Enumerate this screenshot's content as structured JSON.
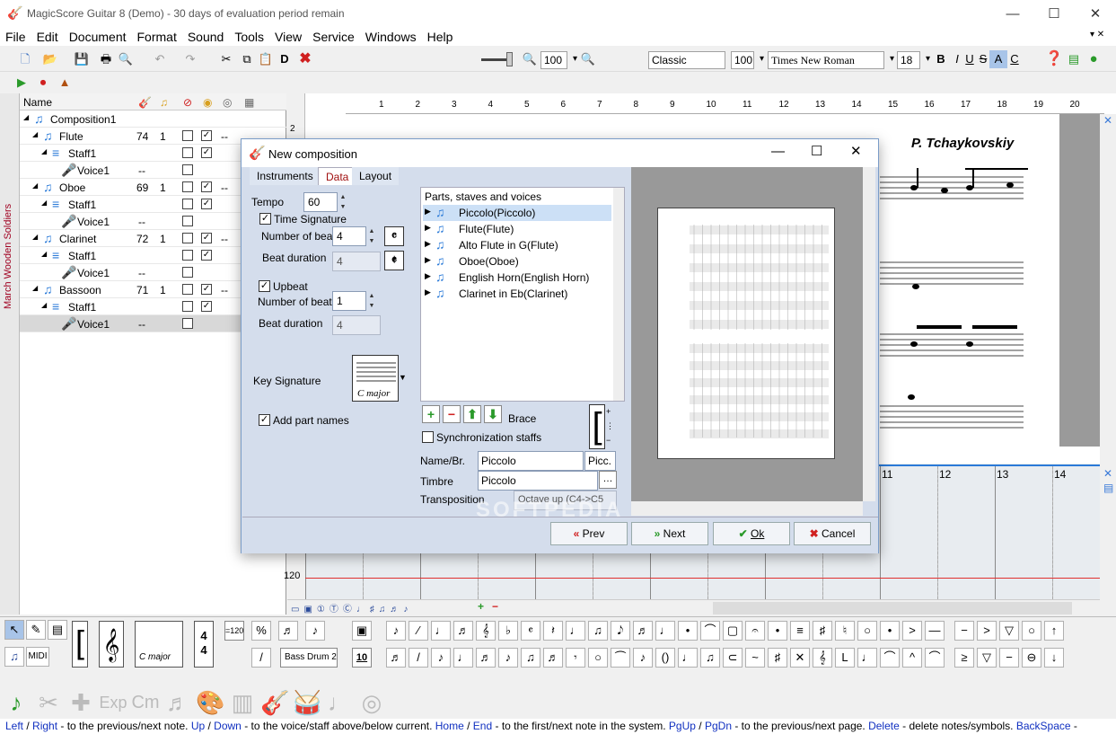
{
  "window": {
    "title": "MagicScore Guitar 8 (Demo) - 30 days of evaluation period remain"
  },
  "menu": [
    "File",
    "Edit",
    "Document",
    "Format",
    "Sound",
    "Tools",
    "View",
    "Service",
    "Windows",
    "Help"
  ],
  "toolbar": {
    "zoom": "100",
    "style": "Classic",
    "style_size": "100",
    "font": "Times New Roman",
    "font_size": "18",
    "bold": "B",
    "italic": "I",
    "underline": "U",
    "strike": "S",
    "highlight": "A",
    "color": "C",
    "delete_label": "D"
  },
  "side_tab": "March Wooden Soldiers",
  "tree": {
    "header": {
      "name": "Name"
    },
    "rows": [
      {
        "label": "Composition1",
        "indent": 0,
        "kind": "comp"
      },
      {
        "label": "Flute",
        "num": "74",
        "ch": "1",
        "indent": 1,
        "kind": "part",
        "c1": false,
        "c2": true,
        "dash": "--"
      },
      {
        "label": "Staff1",
        "indent": 2,
        "kind": "staff",
        "c1": false,
        "c2": true
      },
      {
        "label": "Voice1",
        "indent": 3,
        "kind": "voice",
        "dash": "--",
        "c1": false
      },
      {
        "label": "Oboe",
        "num": "69",
        "ch": "1",
        "indent": 1,
        "kind": "part",
        "c1": false,
        "c2": true,
        "dash": "--"
      },
      {
        "label": "Staff1",
        "indent": 2,
        "kind": "staff",
        "c1": false,
        "c2": true
      },
      {
        "label": "Voice1",
        "indent": 3,
        "kind": "voice",
        "dash": "--",
        "c1": false
      },
      {
        "label": "Clarinet",
        "num": "72",
        "ch": "1",
        "indent": 1,
        "kind": "part",
        "c1": false,
        "c2": true,
        "dash": "--"
      },
      {
        "label": "Staff1",
        "indent": 2,
        "kind": "staff",
        "c1": false,
        "c2": true
      },
      {
        "label": "Voice1",
        "indent": 3,
        "kind": "voice",
        "dash": "--",
        "c1": false
      },
      {
        "label": "Bassoon",
        "num": "71",
        "ch": "1",
        "indent": 1,
        "kind": "part",
        "c1": false,
        "c2": true,
        "dash": "--"
      },
      {
        "label": "Staff1",
        "indent": 2,
        "kind": "staff",
        "c1": false,
        "c2": true
      },
      {
        "label": "Voice1",
        "indent": 3,
        "kind": "voice",
        "dash": "--",
        "c1": false,
        "selected": true
      }
    ]
  },
  "ruler_numbers": [
    "1",
    "2",
    "3",
    "4",
    "5",
    "6",
    "7",
    "8",
    "9",
    "10",
    "11",
    "12",
    "13",
    "14",
    "15",
    "16",
    "17",
    "18",
    "19",
    "20"
  ],
  "score": {
    "composer": "P. Tchaykovskiy"
  },
  "pianoroll": {
    "measures": [
      "11",
      "12",
      "13",
      "14"
    ],
    "pitch": "120",
    "side_num": "2"
  },
  "dialog": {
    "title": "New composition",
    "tabs": [
      "Instruments",
      "Data",
      "Layout"
    ],
    "active_tab": "Data",
    "tempo_label": "Tempo",
    "tempo": "60",
    "time_signature_label": "Time Signature",
    "time_signature_checked": true,
    "beats_label": "Number of beats",
    "beats": "4",
    "beat_duration_label": "Beat duration",
    "beat_duration": "4",
    "upbeat_label": "Upbeat",
    "upbeat_checked": true,
    "upbeat_beats_label": "Number of beats",
    "upbeat_beats": "1",
    "upbeat_duration_label": "Beat duration",
    "upbeat_duration": "4",
    "key_signature_label": "Key Signature",
    "key_signature": "C major",
    "add_part_names_label": "Add part names",
    "add_part_names_checked": true,
    "parts_header": "Parts, staves and voices",
    "parts": [
      "Piccolo(Piccolo)",
      "Flute(Flute)",
      "Alto Flute in G(Flute)",
      "Oboe(Oboe)",
      "English Horn(English Horn)",
      "Clarinet in Eb(Clarinet)"
    ],
    "selected_part": 0,
    "brace_label": "Brace",
    "sync_staffs_label": "Synchronization staffs",
    "name_label": "Name/Br.",
    "name_value": "Piccolo",
    "short_name": "Picc.",
    "timbre_label": "Timbre",
    "timbre_value": "Piccolo",
    "transposition_label": "Transposition",
    "transposition_value": "Octave up (C4->C5",
    "buttons": {
      "prev": "Prev",
      "next": "Next",
      "ok": "Ok",
      "cancel": "Cancel"
    }
  },
  "palette": {
    "bass_drum": "Bass Drum 2",
    "time_sig_top": "4",
    "time_sig_bottom": "4",
    "key_label": "C major",
    "midi": "MIDI",
    "tempo_mark": "=120",
    "num_10": "10"
  },
  "status": [
    {
      "k": "Left",
      "t": " / "
    },
    {
      "k": "Right",
      "t": " - to the previous/next note. "
    },
    {
      "k": "Up",
      "t": " / "
    },
    {
      "k": "Down",
      "t": " - to the voice/staff above/below current. "
    },
    {
      "k": "Home",
      "t": " / "
    },
    {
      "k": "End",
      "t": " - to the first/next note in the system. "
    },
    {
      "k": "PgUp",
      "t": " / "
    },
    {
      "k": "PgDn",
      "t": " - to the previous/next page. "
    },
    {
      "k": "Delete",
      "t": " - delete notes/symbols. "
    },
    {
      "k": "BackSpace",
      "t": " -"
    }
  ],
  "watermark": "SOFTPEDIA",
  "colors": {
    "accent": "#2a7ad8",
    "status_key": "#1030c0",
    "cancel_red": "#d02020",
    "ok_green": "#20a030"
  }
}
